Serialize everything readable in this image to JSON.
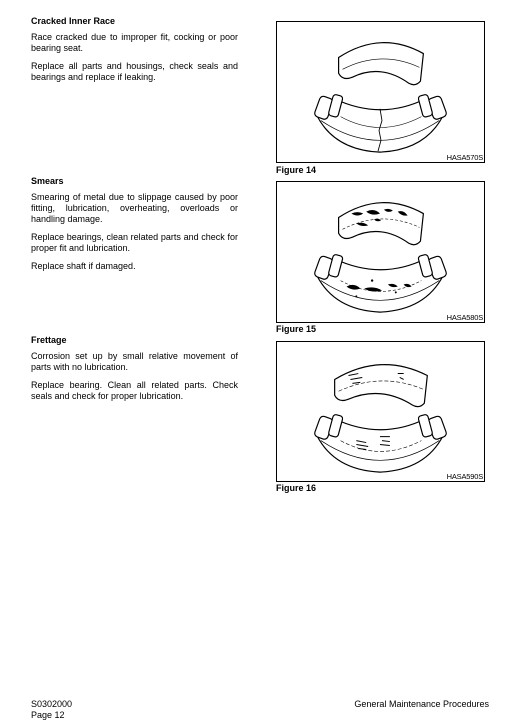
{
  "sections": [
    {
      "heading": "Cracked Inner Race",
      "paragraphs": [
        "Race cracked due to improper fit, cocking or poor bearing seat.",
        "Replace all parts and housings, check seals and bearings and replace if leaking."
      ]
    },
    {
      "heading": "Smears",
      "paragraphs": [
        "Smearing of metal due to slippage caused by poor fitting, lubrication, overheating, overloads or handling damage.",
        "Replace bearings, clean related parts and check for proper fit and lubrication.",
        "Replace shaft if damaged."
      ]
    },
    {
      "heading": "Frettage",
      "paragraphs": [
        "Corrosion set up by small relative movement of parts with no lubrication.",
        "Replace bearing. Clean all related parts. Check seals and check for proper lubrication."
      ]
    }
  ],
  "figures": [
    {
      "caption": "Figure 14",
      "code": "HASA570S",
      "illustration": "bearing-cracked-inner-race"
    },
    {
      "caption": "Figure 15",
      "code": "HASA580S",
      "illustration": "bearing-smears"
    },
    {
      "caption": "Figure 16",
      "code": "HASA590S",
      "illustration": "bearing-frettage"
    }
  ],
  "footer": {
    "doc_code": "S0302000",
    "page": "Page 12",
    "title": "General Maintenance Procedures"
  }
}
